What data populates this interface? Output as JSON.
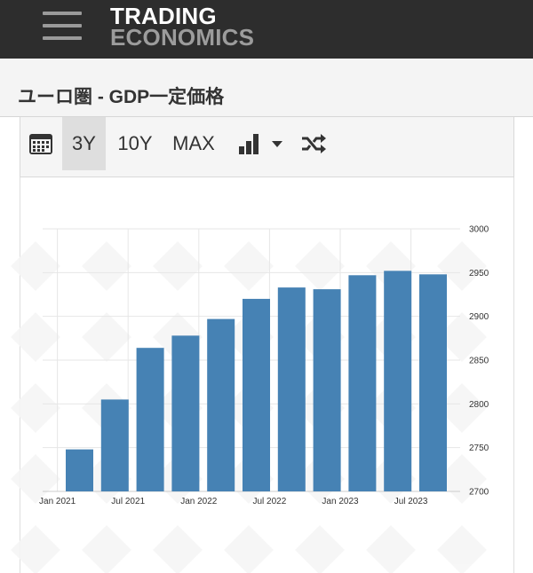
{
  "header": {
    "logo_line1": "TRADING",
    "logo_line2": "ECONOMICS"
  },
  "page": {
    "title": "ユーロ圏 - GDP一定価格"
  },
  "toolbar": {
    "range_3y": "3Y",
    "range_10y": "10Y",
    "range_max": "MAX",
    "active_range": "3Y",
    "icons": [
      "calendar-icon",
      "bar-chart-icon",
      "chevron-down-icon",
      "shuffle-icon"
    ]
  },
  "colors": {
    "bar": "#4682b4",
    "topbar": "#2d2d2d"
  },
  "chart_data": {
    "type": "bar",
    "categories": [
      "2021-Q1",
      "2021-Q2",
      "2021-Q3",
      "2021-Q4",
      "2022-Q1",
      "2022-Q2",
      "2022-Q3",
      "2022-Q4",
      "2023-Q1",
      "2023-Q2",
      "2023-Q3"
    ],
    "values": [
      2748,
      2805,
      2864,
      2878,
      2897,
      2920,
      2933,
      2931,
      2947,
      2952,
      2948
    ],
    "x_tick_labels": [
      "Jan 2021",
      "Jul 2021",
      "Jan 2022",
      "Jul 2022",
      "Jan 2023",
      "Jul 2023"
    ],
    "y_ticks": [
      2700,
      2750,
      2800,
      2850,
      2900,
      2950,
      3000
    ],
    "ylim": [
      2700,
      3000
    ],
    "y_axis_side": "right",
    "grid": true,
    "title": "",
    "xlabel": "",
    "ylabel": ""
  }
}
